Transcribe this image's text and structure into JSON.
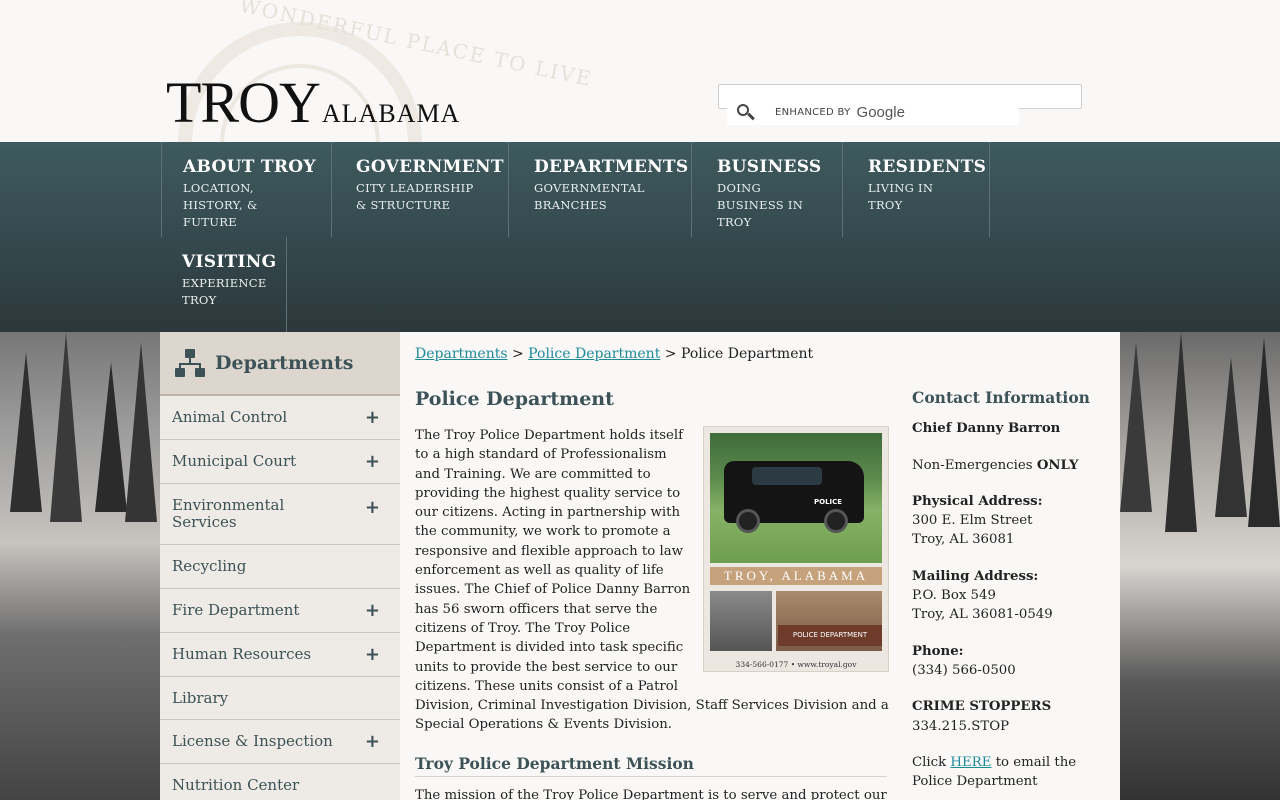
{
  "header": {
    "seal_text": "WONDERFUL PLACE TO LIVE",
    "logo_main": "TROY",
    "logo_sub": "ALABAMA",
    "search": {
      "enhanced_by": "ENHANCED BY",
      "provider": "Google",
      "placeholder": ""
    }
  },
  "nav": [
    {
      "title": "ABOUT TROY",
      "sub": "LOCATION, HISTORY, & FUTURE"
    },
    {
      "title": "GOVERNMENT",
      "sub": "CITY LEADERSHIP & STRUCTURE"
    },
    {
      "title": "DEPARTMENTS",
      "sub": "GOVERNMENTAL BRANCHES"
    },
    {
      "title": "BUSINESS",
      "sub": "DOING BUSINESS IN TROY"
    },
    {
      "title": "RESIDENTS",
      "sub": "LIVING IN TROY"
    },
    {
      "title": "VISITING",
      "sub": "EXPERIENCE TROY"
    }
  ],
  "sidebar": {
    "title": "Departments",
    "icon": "sitemap-icon",
    "items": [
      {
        "label": "Animal Control",
        "expand": "+"
      },
      {
        "label": "Municipal Court",
        "expand": "+"
      },
      {
        "label": "Environmental Services",
        "expand": "+"
      },
      {
        "label": "Recycling",
        "expand": ""
      },
      {
        "label": "Fire Department",
        "expand": "+"
      },
      {
        "label": "Human Resources",
        "expand": "+"
      },
      {
        "label": "Library",
        "expand": ""
      },
      {
        "label": "License & Inspection",
        "expand": "+"
      },
      {
        "label": "Nutrition Center",
        "expand": ""
      }
    ]
  },
  "breadcrumb": {
    "link1": "Departments",
    "sep": ">",
    "link2": "Police Department",
    "current": "Police Department"
  },
  "main": {
    "title": "Police Department",
    "body": "The Troy Police Department holds itself to a high standard of Professionalism and Training. We are committed to providing the highest quality service to our citizens. Acting in partnership with the community, we work to promote a responsive and flexible approach to law enforcement as well as quality of life issues. The Chief of Police Danny Barron has 56 sworn officers that serve the citizens of Troy.  The Troy Police Department is divided into task specific units to provide the best service to our citizens.  These units consist of a Patrol Division, Criminal Investigation Division, Staff Services Division and a Special Operations & Events Division.",
    "photo": {
      "car_label": "POLICE",
      "banner": "TROY, ALABAMA",
      "building_sign": "POLICE DEPARTMENT",
      "footer": "334-566-0177  •  www.troyal.gov"
    },
    "mission_title": "Troy Police Department Mission",
    "mission_text": "The mission of the Troy Police Department is to serve and protect our"
  },
  "contact": {
    "title": "Contact Information",
    "chief": "Chief Danny Barron",
    "non_emergency_prefix": "Non-Emergencies",
    "non_emergency_strong": "ONLY",
    "physical_label": "Physical Address:",
    "physical_line1": "300 E. Elm Street",
    "physical_line2": "Troy, AL 36081",
    "mailing_label": "Mailing Address:",
    "mailing_line1": "P.O. Box 549",
    "mailing_line2": "Troy, AL 36081-0549",
    "phone_label": "Phone:",
    "phone": "(334) 566-0500",
    "crime_label": "CRIME STOPPERS",
    "crime_number": "334.215.STOP",
    "click_prefix": "Click",
    "here": "HERE",
    "click_suffix": "to email the",
    "click_line2": "Police Department"
  },
  "colors": {
    "nav_bg": "#34484c",
    "accent": "#3c5256",
    "link": "#1e8a9c"
  }
}
